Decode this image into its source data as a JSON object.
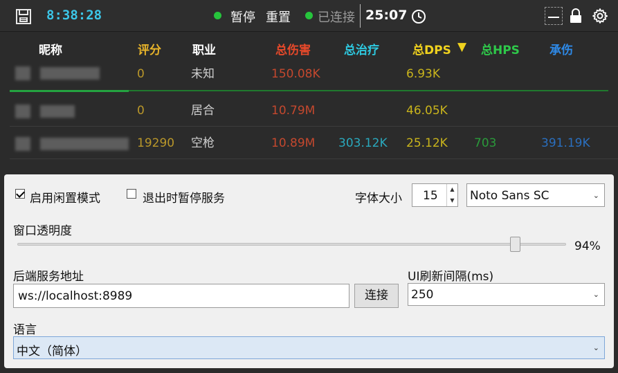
{
  "titlebar": {
    "clock": "8:38:28",
    "pause_label": "暂停",
    "reset_label": "重置",
    "connection_status": "已连接",
    "timer": "25:07",
    "status_color": "#26c43c",
    "clock_color": "#3cc6e8"
  },
  "table": {
    "headers": [
      {
        "label": "昵称",
        "color": "#ffffff"
      },
      {
        "label": "评分",
        "color": "#e8b42a"
      },
      {
        "label": "职业",
        "color": "#ffffff"
      },
      {
        "label": "总伤害",
        "color": "#e8492a"
      },
      {
        "label": "总治疗",
        "color": "#2ec9e0"
      },
      {
        "label": "总DPS",
        "color": "#f0d21e"
      },
      {
        "label": "总HPS",
        "color": "#2ec94a"
      },
      {
        "label": "承伤",
        "color": "#2e8ae8"
      }
    ],
    "sort_indicator": "▼",
    "rows": [
      {
        "score": "0",
        "class": "未知",
        "damage": "150.08K",
        "healing": "",
        "dps": "6.93K",
        "hps": "",
        "taken": ""
      },
      {
        "score": "0",
        "class": "居合",
        "damage": "10.79M",
        "healing": "",
        "dps": "46.05K",
        "hps": "",
        "taken": ""
      },
      {
        "score": "19290",
        "class": "空枪",
        "damage": "10.89M",
        "healing": "303.12K",
        "dps": "25.12K",
        "hps": "703",
        "taken": "391.19K"
      }
    ]
  },
  "settings": {
    "idle_mode_label": "启用闲置模式",
    "idle_mode_checked": true,
    "pause_on_exit_label": "退出时暂停服务",
    "pause_on_exit_checked": false,
    "font_size_label": "字体大小",
    "font_size_value": "15",
    "font_family_value": "Noto Sans SC",
    "opacity_label": "窗口透明度",
    "opacity_value": "94%",
    "opacity_fraction": 0.94,
    "backend_label": "后端服务地址",
    "backend_value": "ws://localhost:8989",
    "connect_button": "连接",
    "refresh_label": "UI刷新间隔(ms)",
    "refresh_value": "250",
    "language_label": "语言",
    "language_value": "中文（简体）"
  }
}
